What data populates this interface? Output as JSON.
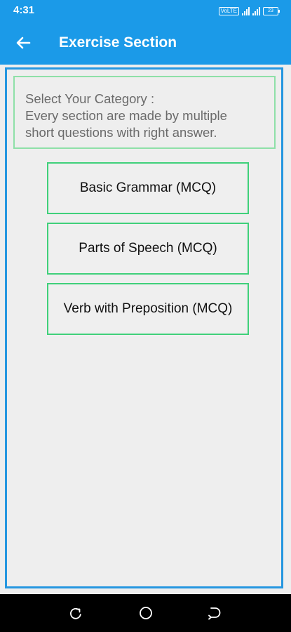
{
  "status_bar": {
    "time": "4:31",
    "volte": "VoLTE",
    "battery": "23"
  },
  "app_bar": {
    "title": "Exercise Section",
    "back_icon": "arrow-left-icon"
  },
  "category_box": {
    "line1": "Select Your Category :",
    "line2": "Every section are made by multiple",
    "line3": "short questions with right answer."
  },
  "categories": [
    {
      "label": "Basic Grammar (MCQ)"
    },
    {
      "label": "Parts of Speech (MCQ)"
    },
    {
      "label": "Verb with Preposition (MCQ)"
    }
  ],
  "nav_bar": {
    "icons": [
      "recents-icon",
      "home-icon",
      "back-icon"
    ]
  },
  "colors": {
    "primary": "#1b9ae8",
    "border_blue": "#2697e0",
    "border_green": "#3fd07a",
    "background": "#eeeeee"
  }
}
